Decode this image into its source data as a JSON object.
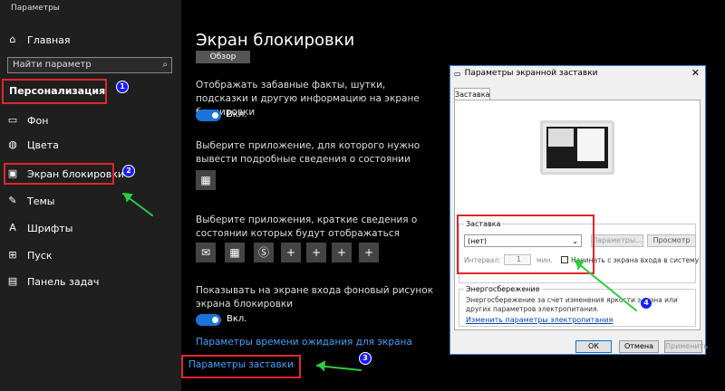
{
  "window": {
    "title": "Параметры"
  },
  "sidebar": {
    "home_label": "Главная",
    "search_placeholder": "Найти параметр",
    "section_title": "Персонализация",
    "items": [
      {
        "label": "Фон",
        "icon": "image-icon"
      },
      {
        "label": "Цвета",
        "icon": "palette-icon"
      },
      {
        "label": "Экран блокировки",
        "icon": "lock-screen-icon"
      },
      {
        "label": "Темы",
        "icon": "brush-icon"
      },
      {
        "label": "Шрифты",
        "icon": "font-icon"
      },
      {
        "label": "Пуск",
        "icon": "start-icon"
      },
      {
        "label": "Панель задач",
        "icon": "taskbar-icon"
      }
    ]
  },
  "main": {
    "title": "Экран блокировки",
    "review_button": "Обзор",
    "fun_facts_text": "Отображать забавные факты, шутки, подсказки и другую информацию на экране блокировки",
    "toggle1_label": "Вкл.",
    "detailed_app_text": "Выберите приложение, для которого нужно вывести подробные сведения о состоянии",
    "quick_apps_text": "Выберите приложения, краткие сведения о состоянии которых будут отображаться",
    "plus_symbol": "+",
    "background_text": "Показывать на экране входа фоновый рисунок экрана блокировки",
    "toggle2_label": "Вкл.",
    "timeout_link": "Параметры времени ожидания для экрана",
    "screensaver_link": "Параметры заставки"
  },
  "dialog": {
    "title": "Параметры экранной заставки",
    "close_symbol": "✕",
    "tab_label": "Заставка",
    "screensaver_group_label": "Заставка",
    "screensaver_select_value": "(нет)",
    "params_button": "Параметры...",
    "preview_button": "Просмотр",
    "interval_label": "Интервал:",
    "interval_value": "1",
    "interval_unit": "мин.",
    "start_on_login_label": "Начинать с экрана входа в систему",
    "power_group_label": "Энергосбережение",
    "power_text": "Энергосбережение за счет изменения яркости экрана или других параметров электропитания.",
    "power_link": "Изменить параметры электропитания",
    "ok_button": "ОК",
    "cancel_button": "Отмена",
    "apply_button": "Применить"
  },
  "annotations": {
    "badges": [
      "1",
      "2",
      "3",
      "4"
    ]
  },
  "colors": {
    "accent": "#1a73d9",
    "highlight_box": "#e0262b",
    "arrow": "#2ecc40",
    "badge": "#1a1aff"
  }
}
